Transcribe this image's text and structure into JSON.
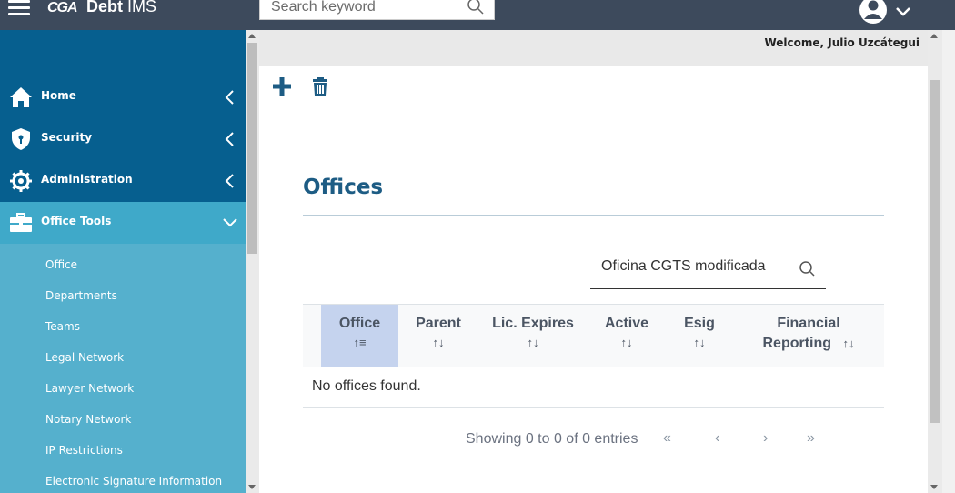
{
  "app": {
    "logo_mark": "CGA",
    "app_name_bold": "Debt",
    "app_name_rest": "IMS"
  },
  "header": {
    "search_placeholder": "Search keyword"
  },
  "welcome": "Welcome, Julio Uzcátegui",
  "sidebar": {
    "items": [
      {
        "label": "Home",
        "icon": "home-icon"
      },
      {
        "label": "Security",
        "icon": "shield-icon"
      },
      {
        "label": "Administration",
        "icon": "gear-icon"
      },
      {
        "label": "Office Tools",
        "icon": "briefcase-icon"
      }
    ],
    "subitems": [
      "Office",
      "Departments",
      "Teams",
      "Legal Network",
      "Lawyer Network",
      "Notary Network",
      "IP Restrictions",
      "Electronic Signature Information"
    ]
  },
  "page": {
    "title": "Offices",
    "filter_value": "Oficina CGTS modificada",
    "columns": [
      "Office",
      "Parent",
      "Lic. Expires",
      "Active",
      "Esig",
      "Financial",
      "Reporting"
    ],
    "empty_message": "No offices found.",
    "paging_info": "Showing 0 to 0 of 0 entries",
    "paging": {
      "first": "«",
      "prev": "‹",
      "next": "›",
      "last": "»"
    }
  },
  "colors": {
    "topbar": "#3d4a5c",
    "sidebar": "#065f8f",
    "active": "#3fa9c9",
    "subnav": "#55b0cd",
    "title": "#1d5c84"
  }
}
